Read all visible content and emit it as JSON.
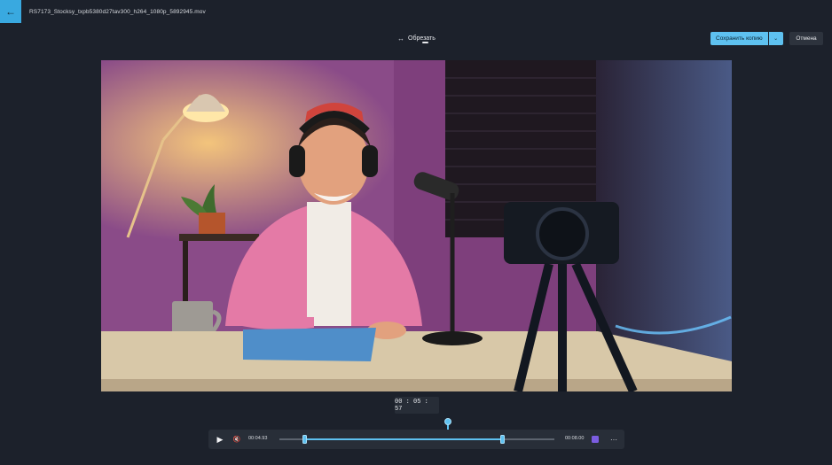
{
  "titlebar": {
    "back_icon": "arrow-left-icon",
    "file_name": "RS7173_Stocksy_txpb5380d27tav300_h264_1080p_5892945.mov"
  },
  "mode": {
    "icon": "trim-icon",
    "label": "Обрезать"
  },
  "actions": {
    "save_label": "Сохранить копию",
    "save_dropdown_icon": "chevron-down-icon",
    "cancel_label": "Отмена"
  },
  "player": {
    "current_time": "00 : 05 : 57",
    "start_time": "00:04.93",
    "end_time": "00:08.00",
    "play_icon": "play-icon",
    "mute_icon": "mute-icon",
    "clip_icon": "clip-icon",
    "more_icon": "more-icon"
  },
  "colors": {
    "accent": "#5ec1f0",
    "background": "#1c212b",
    "panel": "#282e38"
  }
}
